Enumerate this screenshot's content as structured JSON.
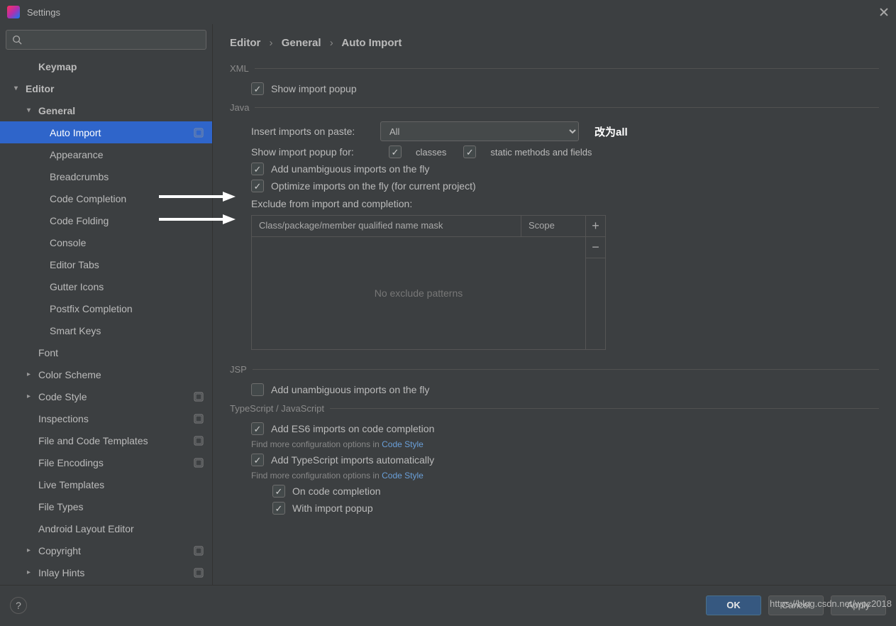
{
  "window": {
    "title": "Settings"
  },
  "sidebar": {
    "items": [
      {
        "label": "Keymap",
        "indent": 2,
        "bold": true,
        "arrow": ""
      },
      {
        "label": "Editor",
        "indent": 1,
        "bold": true,
        "arrow": "▾"
      },
      {
        "label": "General",
        "indent": 2,
        "bold": true,
        "arrow": "▾"
      },
      {
        "label": "Auto Import",
        "indent": 3,
        "selected": true,
        "scope": true
      },
      {
        "label": "Appearance",
        "indent": 3
      },
      {
        "label": "Breadcrumbs",
        "indent": 3
      },
      {
        "label": "Code Completion",
        "indent": 3
      },
      {
        "label": "Code Folding",
        "indent": 3
      },
      {
        "label": "Console",
        "indent": 3
      },
      {
        "label": "Editor Tabs",
        "indent": 3
      },
      {
        "label": "Gutter Icons",
        "indent": 3
      },
      {
        "label": "Postfix Completion",
        "indent": 3
      },
      {
        "label": "Smart Keys",
        "indent": 3
      },
      {
        "label": "Font",
        "indent": 2
      },
      {
        "label": "Color Scheme",
        "indent": 2,
        "arrow": "▸"
      },
      {
        "label": "Code Style",
        "indent": 2,
        "arrow": "▸",
        "scope": true
      },
      {
        "label": "Inspections",
        "indent": 2,
        "scope": true
      },
      {
        "label": "File and Code Templates",
        "indent": 2,
        "scope": true
      },
      {
        "label": "File Encodings",
        "indent": 2,
        "scope": true
      },
      {
        "label": "Live Templates",
        "indent": 2
      },
      {
        "label": "File Types",
        "indent": 2
      },
      {
        "label": "Android Layout Editor",
        "indent": 2
      },
      {
        "label": "Copyright",
        "indent": 2,
        "arrow": "▸",
        "scope": true
      },
      {
        "label": "Inlay Hints",
        "indent": 2,
        "arrow": "▸",
        "scope": true
      }
    ]
  },
  "breadcrumb": {
    "p1": "Editor",
    "p2": "General",
    "p3": "Auto Import"
  },
  "sections": {
    "xml": {
      "label": "XML",
      "show_import_popup": "Show import popup"
    },
    "java": {
      "label": "Java",
      "insert_on_paste": "Insert imports on paste:",
      "insert_value": "All",
      "annot": "改为all",
      "popup_for": "Show import popup for:",
      "classes": "classes",
      "static": "static methods and fields",
      "unambiguous": "Add unambiguous imports on the fly",
      "optimize": "Optimize imports on the fly (for current project)",
      "exclude_label": "Exclude from import and completion:",
      "exclude_header_name": "Class/package/member qualified name mask",
      "exclude_header_scope": "Scope",
      "exclude_empty": "No exclude patterns"
    },
    "jsp": {
      "label": "JSP",
      "unambiguous": "Add unambiguous imports on the fly"
    },
    "ts": {
      "label": "TypeScript / JavaScript",
      "es6": "Add ES6 imports on code completion",
      "hint1a": "Find more configuration options in ",
      "hint_link": "Code Style",
      "ts_auto": "Add TypeScript imports automatically",
      "on_complete": "On code completion",
      "with_popup": "With import popup"
    }
  },
  "footer": {
    "ok": "OK",
    "cancel": "Cancel",
    "apply": "Apply"
  },
  "watermark": "https://blog.csdn.net/wpc2018"
}
